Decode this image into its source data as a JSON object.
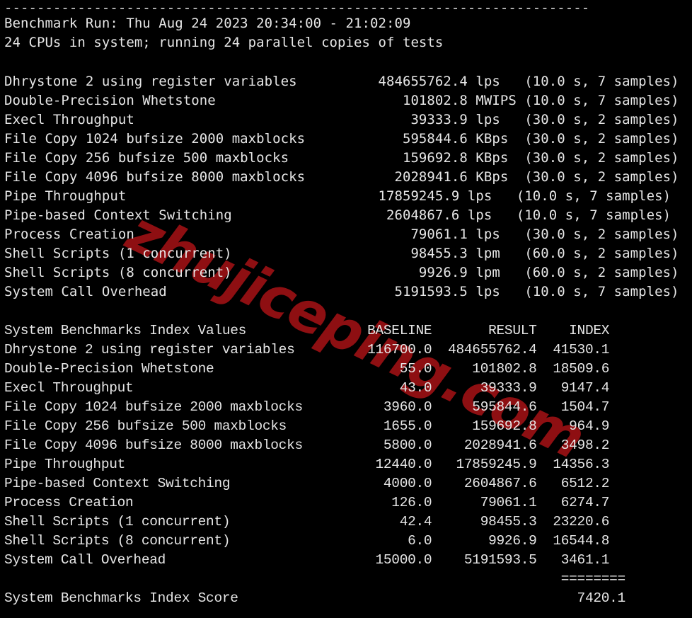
{
  "terminal": {
    "background_color": "#000000",
    "text_color": "#e6e6e6",
    "watermark": {
      "text": "zhujiceping.com",
      "color": "#8e0f12",
      "rotation_degrees": 25.5
    }
  },
  "header": {
    "divider": "------------------------------------------------------------------------",
    "benchmark_run": "Benchmark Run: Thu Aug 24 2023 20:34:00 - 21:02:09",
    "cpu_line": "24 CPUs in system; running 24 parallel copies of tests"
  },
  "raw_results": {
    "rows": [
      {
        "name": "Dhrystone 2 using register variables",
        "value": "484655762.4",
        "unit": "lps",
        "duration": "10.0",
        "samples": "7"
      },
      {
        "name": "Double-Precision Whetstone",
        "value": "101802.8",
        "unit": "MWIPS",
        "duration": "10.0",
        "samples": "7"
      },
      {
        "name": "Execl Throughput",
        "value": "39333.9",
        "unit": "lps",
        "duration": "30.0",
        "samples": "2"
      },
      {
        "name": "File Copy 1024 bufsize 2000 maxblocks",
        "value": "595844.6",
        "unit": "KBps",
        "duration": "30.0",
        "samples": "2"
      },
      {
        "name": "File Copy 256 bufsize 500 maxblocks",
        "value": "159692.8",
        "unit": "KBps",
        "duration": "30.0",
        "samples": "2"
      },
      {
        "name": "File Copy 4096 bufsize 8000 maxblocks",
        "value": "2028941.6",
        "unit": "KBps",
        "duration": "30.0",
        "samples": "2"
      },
      {
        "name": "Pipe Throughput",
        "value": "17859245.9",
        "unit": "lps",
        "duration": "10.0",
        "samples": "7"
      },
      {
        "name": "Pipe-based Context Switching",
        "value": "2604867.6",
        "unit": "lps",
        "duration": "10.0",
        "samples": "7"
      },
      {
        "name": "Process Creation",
        "value": "79061.1",
        "unit": "lps",
        "duration": "30.0",
        "samples": "2"
      },
      {
        "name": "Shell Scripts (1 concurrent)",
        "value": "98455.3",
        "unit": "lpm",
        "duration": "60.0",
        "samples": "2"
      },
      {
        "name": "Shell Scripts (8 concurrent)",
        "value": "9926.9",
        "unit": "lpm",
        "duration": "60.0",
        "samples": "2"
      },
      {
        "name": "System Call Overhead",
        "value": "5191593.5",
        "unit": "lps",
        "duration": "10.0",
        "samples": "7"
      }
    ],
    "lines": [
      "Dhrystone 2 using register variables          484655762.4 lps   (10.0 s, 7 samples)",
      "Double-Precision Whetstone                       101802.8 MWIPS (10.0 s, 7 samples)",
      "Execl Throughput                                  39333.9 lps   (30.0 s, 2 samples)",
      "File Copy 1024 bufsize 2000 maxblocks            595844.6 KBps  (30.0 s, 2 samples)",
      "File Copy 256 bufsize 500 maxblocks              159692.8 KBps  (30.0 s, 2 samples)",
      "File Copy 4096 bufsize 8000 maxblocks           2028941.6 KBps  (30.0 s, 2 samples)",
      "Pipe Throughput                               17859245.9 lps   (10.0 s, 7 samples)",
      "Pipe-based Context Switching                   2604867.6 lps   (10.0 s, 7 samples)",
      "Process Creation                                  79061.1 lps   (30.0 s, 2 samples)",
      "Shell Scripts (1 concurrent)                      98455.3 lpm   (60.0 s, 2 samples)",
      "Shell Scripts (8 concurrent)                       9926.9 lpm   (60.0 s, 2 samples)",
      "System Call Overhead                            5191593.5 lps   (10.0 s, 7 samples)"
    ]
  },
  "index_table": {
    "title": "System Benchmarks Index Values",
    "columns": [
      "BASELINE",
      "RESULT",
      "INDEX"
    ],
    "header_line": "System Benchmarks Index Values               BASELINE       RESULT    INDEX",
    "rows": [
      {
        "name": "Dhrystone 2 using register variables",
        "baseline": "116700.0",
        "result": "484655762.4",
        "index": "41530.1",
        "line": "Dhrystone 2 using register variables         116700.0  484655762.4  41530.1"
      },
      {
        "name": "Double-Precision Whetstone",
        "baseline": "55.0",
        "result": "101802.8",
        "index": "18509.6",
        "line": "Double-Precision Whetstone                       55.0     101802.8  18509.6"
      },
      {
        "name": "Execl Throughput",
        "baseline": "43.0",
        "result": "39333.9",
        "index": "9147.4",
        "line": "Execl Throughput                                 43.0      39333.9   9147.4"
      },
      {
        "name": "File Copy 1024 bufsize 2000 maxblocks",
        "baseline": "3960.0",
        "result": "595844.6",
        "index": "1504.7",
        "line": "File Copy 1024 bufsize 2000 maxblocks          3960.0     595844.6   1504.7"
      },
      {
        "name": "File Copy 256 bufsize 500 maxblocks",
        "baseline": "1655.0",
        "result": "159692.8",
        "index": "964.9",
        "line": "File Copy 256 bufsize 500 maxblocks            1655.0     159692.8    964.9"
      },
      {
        "name": "File Copy 4096 bufsize 8000 maxblocks",
        "baseline": "5800.0",
        "result": "2028941.6",
        "index": "3498.2",
        "line": "File Copy 4096 bufsize 8000 maxblocks          5800.0    2028941.6   3498.2"
      },
      {
        "name": "Pipe Throughput",
        "baseline": "12440.0",
        "result": "17859245.9",
        "index": "14356.3",
        "line": "Pipe Throughput                               12440.0   17859245.9  14356.3"
      },
      {
        "name": "Pipe-based Context Switching",
        "baseline": "4000.0",
        "result": "2604867.6",
        "index": "6512.2",
        "line": "Pipe-based Context Switching                   4000.0    2604867.6   6512.2"
      },
      {
        "name": "Process Creation",
        "baseline": "126.0",
        "result": "79061.1",
        "index": "6274.7",
        "line": "Process Creation                                126.0      79061.1   6274.7"
      },
      {
        "name": "Shell Scripts (1 concurrent)",
        "baseline": "42.4",
        "result": "98455.3",
        "index": "23220.6",
        "line": "Shell Scripts (1 concurrent)                     42.4      98455.3  23220.6"
      },
      {
        "name": "Shell Scripts (8 concurrent)",
        "baseline": "6.0",
        "result": "9926.9",
        "index": "16544.8",
        "line": "Shell Scripts (8 concurrent)                      6.0       9926.9  16544.8"
      },
      {
        "name": "System Call Overhead",
        "baseline": "15000.0",
        "result": "5191593.5",
        "index": "3461.1",
        "line": "System Call Overhead                          15000.0    5191593.5   3461.1"
      }
    ],
    "separator_line": "                                                                     ========",
    "score_label": "System Benchmarks Index Score",
    "score_value": "7420.1",
    "score_line": "System Benchmarks Index Score                                          7420.1"
  }
}
